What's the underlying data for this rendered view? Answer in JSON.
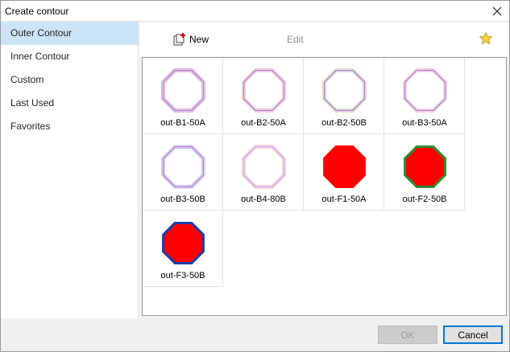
{
  "window": {
    "title": "Create contour"
  },
  "sidebar": {
    "items": [
      {
        "label": "Outer Contour",
        "active": true
      },
      {
        "label": "Inner Contour",
        "active": false
      },
      {
        "label": "Custom",
        "active": false
      },
      {
        "label": "Last Used",
        "active": false
      },
      {
        "label": "Favorites",
        "active": false
      }
    ]
  },
  "toolbar": {
    "new_label": "New",
    "edit_label": "Edit",
    "new_icon": "new-contour-icon",
    "favorite_icon": "star-icon"
  },
  "gallery": {
    "items": [
      {
        "label": "out-B1-50A",
        "style": "lines",
        "lines": [
          "#c9a0c9",
          "#b47fd0",
          "#d9a8c8"
        ]
      },
      {
        "label": "out-B2-50A",
        "style": "lines",
        "lines": [
          "#f0c0c0",
          "#b47fd0",
          "#f2c6d0"
        ]
      },
      {
        "label": "out-B2-50B",
        "style": "lines",
        "lines": [
          "#d8d8b0",
          "#b47fd0",
          "#c8e0c8"
        ]
      },
      {
        "label": "out-B3-50A",
        "style": "lines",
        "lines": [
          "#f4c4c4",
          "#b47fd0",
          "#f6d0d8"
        ]
      },
      {
        "label": "out-B3-50B",
        "style": "lines",
        "lines": [
          "#c8c8e8",
          "#b47fd0",
          "#c0c0f0"
        ]
      },
      {
        "label": "out-B4-80B",
        "style": "lines",
        "lines": [
          "#f0c8c8",
          "#d0a0e0",
          "#f0d0d8"
        ]
      },
      {
        "label": "out-F1-50A",
        "style": "fill",
        "fill": "#ff0000",
        "stroke": "#ff0000"
      },
      {
        "label": "out-F2-50B",
        "style": "fill",
        "fill": "#ff0000",
        "stroke": "#2e8b2e"
      },
      {
        "label": "out-F3-50B",
        "style": "fill",
        "fill": "#ff0000",
        "stroke": "#1c3fa8"
      }
    ]
  },
  "buttons": {
    "ok": "OK",
    "cancel": "Cancel"
  },
  "colors": {
    "accent": "#0078d7",
    "selection": "#cce4f7"
  }
}
